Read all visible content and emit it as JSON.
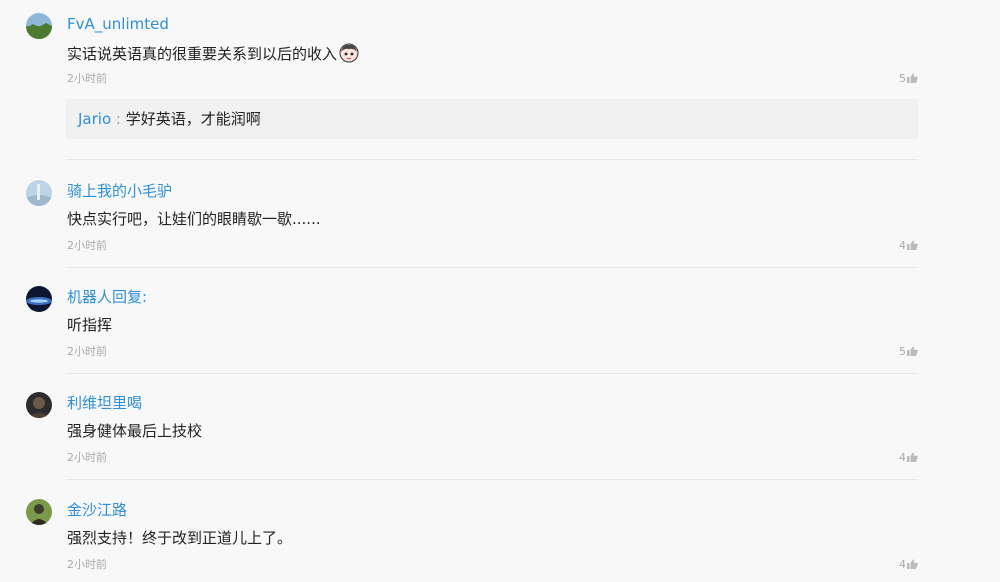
{
  "comments": [
    {
      "username": "FvA_unlimted",
      "content": "实话说英语真的很重要关系到以后的收入",
      "time": "2小时前",
      "likes": "5",
      "avatar_icon": "landscape-avatar-icon",
      "emoji_icon": "cartoon-face-emoji-icon",
      "reply": {
        "username": "Jario",
        "separator": ":",
        "text": "学好英语，才能润啊"
      }
    },
    {
      "username": "骑上我的小毛驴",
      "content": "快点实行吧，让娃们的眼睛歇一歇......",
      "time": "2小时前",
      "likes": "4",
      "avatar_icon": "blue-sky-avatar-icon"
    },
    {
      "username": "机器人回复:",
      "content": "听指挥",
      "time": "2小时前",
      "likes": "5",
      "avatar_icon": "night-sky-avatar-icon"
    },
    {
      "username": "利维坦里喝",
      "content": "强身健体最后上技校",
      "time": "2小时前",
      "likes": "4",
      "avatar_icon": "dark-portrait-avatar-icon"
    },
    {
      "username": "金沙江路",
      "content": "强烈支持！终于改到正道儿上了。",
      "time": "2小时前",
      "likes": "4",
      "avatar_icon": "green-portrait-avatar-icon"
    }
  ],
  "colors": {
    "username": "#2f8fd8",
    "text": "#222222",
    "meta": "#aaaaaa",
    "background": "#f8f8f8",
    "reply_background": "#f1f1f1"
  }
}
